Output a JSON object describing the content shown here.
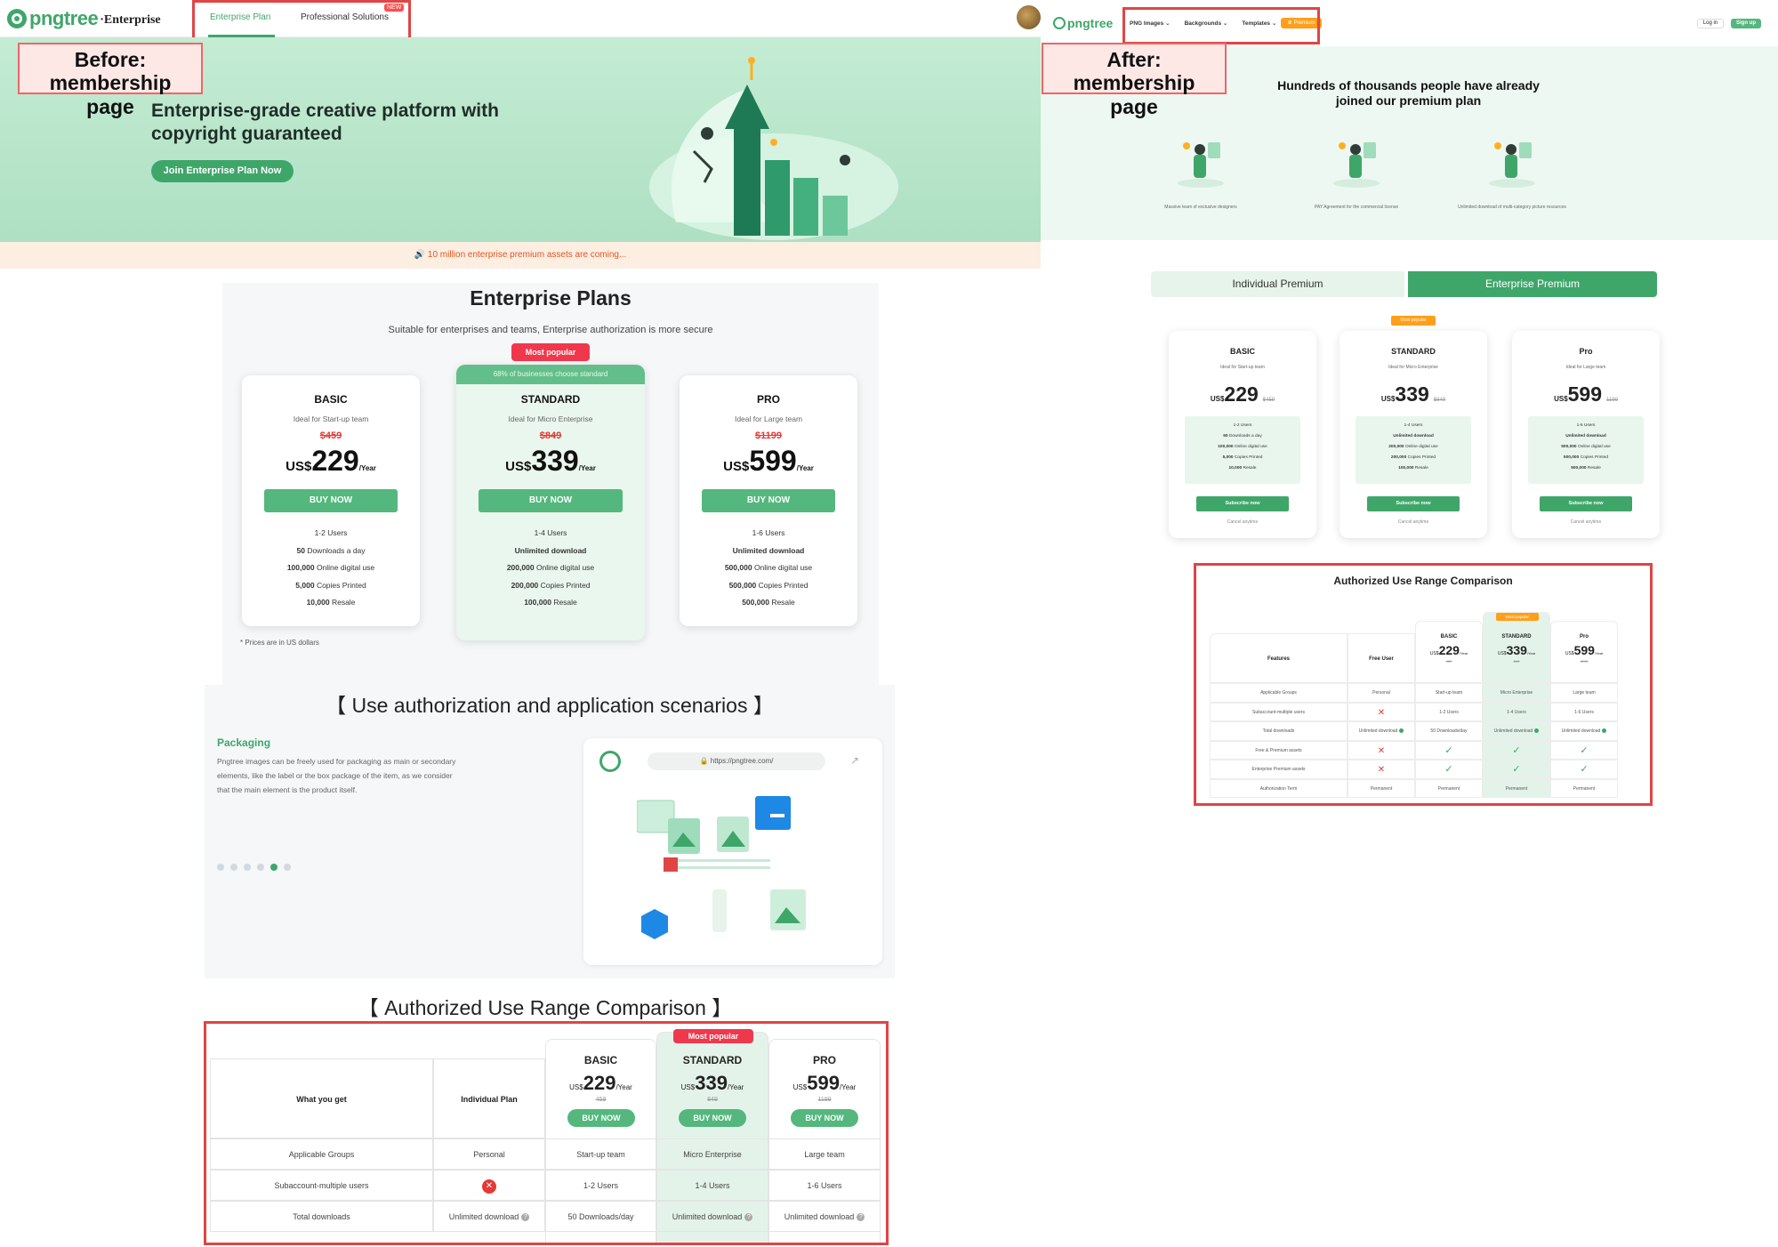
{
  "before": {
    "header": {
      "logo_word": "pngtree",
      "logo_suffix": "·Enterprise",
      "tabs": [
        "Enterprise Plan",
        "Professional Solutions"
      ],
      "new_badge": "NEW"
    },
    "callout": "Before: membership page",
    "hero": {
      "title_line1": "Enterprise-grade creative platform with",
      "title_line2": "copyright guaranteed",
      "cta": "Join Enterprise Plan Now"
    },
    "notice": "10 million enterprise premium assets are coming...",
    "plans": {
      "title": "Enterprise Plans",
      "subtitle": "Suitable for enterprises and teams, Enterprise authorization is more secure",
      "most_popular": "Most popular",
      "standard_banner": "68% of businesses choose standard",
      "note": "* Prices are in US dollars",
      "cards": [
        {
          "name": "BASIC",
          "desc": "Ideal for Start-up team",
          "old": "$459",
          "currency": "US$",
          "price": "229",
          "per": "/Year",
          "buy": "BUY NOW",
          "features": [
            [
              "",
              "1-2 Users"
            ],
            [
              "50",
              "Downloads a day"
            ],
            [
              "100,000",
              "Online digital use"
            ],
            [
              "5,000",
              "Copies Printed"
            ],
            [
              "10,000",
              "Resale"
            ]
          ]
        },
        {
          "name": "STANDARD",
          "desc": "Ideal for Micro Enterprise",
          "old": "$849",
          "currency": "US$",
          "price": "339",
          "per": "/Year",
          "buy": "BUY NOW",
          "features": [
            [
              "",
              "1-4 Users"
            ],
            [
              "Unlimited download",
              ""
            ],
            [
              "200,000",
              "Online digital use"
            ],
            [
              "200,000",
              "Copies Printed"
            ],
            [
              "100,000",
              "Resale"
            ]
          ]
        },
        {
          "name": "PRO",
          "desc": "Ideal for Large team",
          "old": "$1199",
          "currency": "US$",
          "price": "599",
          "per": "/Year",
          "buy": "BUY NOW",
          "features": [
            [
              "",
              "1-6 Users"
            ],
            [
              "Unlimited download",
              ""
            ],
            [
              "500,000",
              "Online digital use"
            ],
            [
              "500,000",
              "Copies Printed"
            ],
            [
              "500,000",
              "Resale"
            ]
          ]
        }
      ]
    },
    "scenarios": {
      "title": "【 Use authorization and application scenarios 】",
      "item_title": "Packaging",
      "item_text_1": "Pngtree images can be freely used for packaging as main or secondary",
      "item_text_2": "elements, like the label or the box package of the item, as we consider",
      "item_text_3": "that the main element is the product itself.",
      "url": "https://pngtree.com/"
    },
    "comparison": {
      "title": "【 Authorized Use Range Comparison 】",
      "most_popular": "Most popular",
      "col_what": "What you get",
      "col_individual": "Individual Plan",
      "plans": [
        {
          "name": "BASIC",
          "currency": "US$",
          "price": "229",
          "per": "/Year",
          "old": "459",
          "buy": "BUY NOW"
        },
        {
          "name": "STANDARD",
          "currency": "US$",
          "price": "339",
          "per": "/Year",
          "old": "849",
          "buy": "BUY NOW"
        },
        {
          "name": "PRO",
          "currency": "US$",
          "price": "599",
          "per": "/Year",
          "old": "1199",
          "buy": "BUY NOW"
        }
      ],
      "rows": [
        [
          "Applicable Groups",
          "Personal",
          "Start-up team",
          "Micro Enterprise",
          "Large team"
        ],
        [
          "Subaccount-multiple users",
          "x",
          "1-2 Users",
          "1-4 Users",
          "1-6 Users"
        ],
        [
          "Total downloads",
          "Unlimited download",
          "50 Downloads/day",
          "Unlimited download",
          "Unlimited download"
        ]
      ]
    }
  },
  "after": {
    "callout": "After: membership page",
    "header": {
      "logo_word": "pngtree",
      "nav": [
        "PNG Images",
        "Backgrounds",
        "Templates"
      ],
      "premium": "Premium",
      "login": "Log in",
      "signup": "Sign up"
    },
    "hero_line1": "Hundreds of thousands people have already",
    "hero_line2": "joined our premium plan",
    "benefits": [
      "Massive team of exclusive designers",
      "PAY Agreement for the commercial license",
      "Unlimited download of multi-category picture resources"
    ],
    "tabs": [
      "Individual Premium",
      "Enterprise Premium"
    ],
    "most_popular": "Most popular",
    "cards": [
      {
        "name": "BASIC",
        "desc": "Ideal for Start-up team",
        "currency": "US$",
        "price": "229",
        "old": "$459",
        "features": [
          [
            "",
            "1-2 Users"
          ],
          [
            "50",
            "Downloads a day"
          ],
          [
            "100,000",
            "Online digital use"
          ],
          [
            "5,000",
            "Copies Printed"
          ],
          [
            "10,000",
            "Resale"
          ]
        ],
        "btn": "Subscribe now",
        "cancel": "Cancel anytime"
      },
      {
        "name": "STANDARD",
        "desc": "Ideal for Micro Enterprise",
        "currency": "US$",
        "price": "339",
        "old": "$849",
        "features": [
          [
            "",
            "1-4 Users"
          ],
          [
            "Unlimited download",
            ""
          ],
          [
            "200,000",
            "Online digital use"
          ],
          [
            "200,000",
            "Copies Printed"
          ],
          [
            "100,000",
            "Resale"
          ]
        ],
        "btn": "Subscribe now",
        "cancel": "Cancel anytime"
      },
      {
        "name": "Pro",
        "desc": "Ideal for Large team",
        "currency": "US$",
        "price": "599",
        "old": "1199",
        "features": [
          [
            "",
            "1-6 Users"
          ],
          [
            "Unlimited download",
            ""
          ],
          [
            "500,000",
            "Online digital use"
          ],
          [
            "500,000",
            "Copies Printed"
          ],
          [
            "500,000",
            "Resale"
          ]
        ],
        "btn": "Subscribe now",
        "cancel": "Cancel anytime"
      }
    ],
    "comparison": {
      "title": "Authorized Use Range Comparison",
      "most_popular": "Most popular",
      "col_features": "Features",
      "col_free": "Free User",
      "plans": [
        {
          "name": "BASIC",
          "currency": "US$",
          "price": "229",
          "per": "/Year",
          "old": "459"
        },
        {
          "name": "STANDARD",
          "currency": "US$",
          "price": "339",
          "per": "/Year",
          "old": "849"
        },
        {
          "name": "Pro",
          "currency": "US$",
          "price": "599",
          "per": "/Year",
          "old": "1199"
        }
      ],
      "rows": [
        [
          "Applicable Groups",
          "Personal",
          "Start-up team",
          "Micro Enterprise",
          "Large team"
        ],
        [
          "Subaccount-multiple users",
          "x",
          "1-2 Users",
          "1-4 Users",
          "1-6 Users"
        ],
        [
          "Total downloads",
          "Unlimited download",
          "50 Downloads/day",
          "Unlimited download",
          "Unlimited download"
        ],
        [
          "Free & Premium assets",
          "x",
          "check",
          "check",
          "check"
        ],
        [
          "Enterprise Premium assets",
          "x",
          "check",
          "check",
          "check"
        ],
        [
          "Authorization Term",
          "Permanent",
          "Permanent",
          "Permanent",
          "Permanent"
        ]
      ]
    }
  },
  "colors": {
    "green": "#3fa66a",
    "button_green": "#54b77d",
    "red": "#e04545",
    "orange": "#ff9f1a"
  }
}
